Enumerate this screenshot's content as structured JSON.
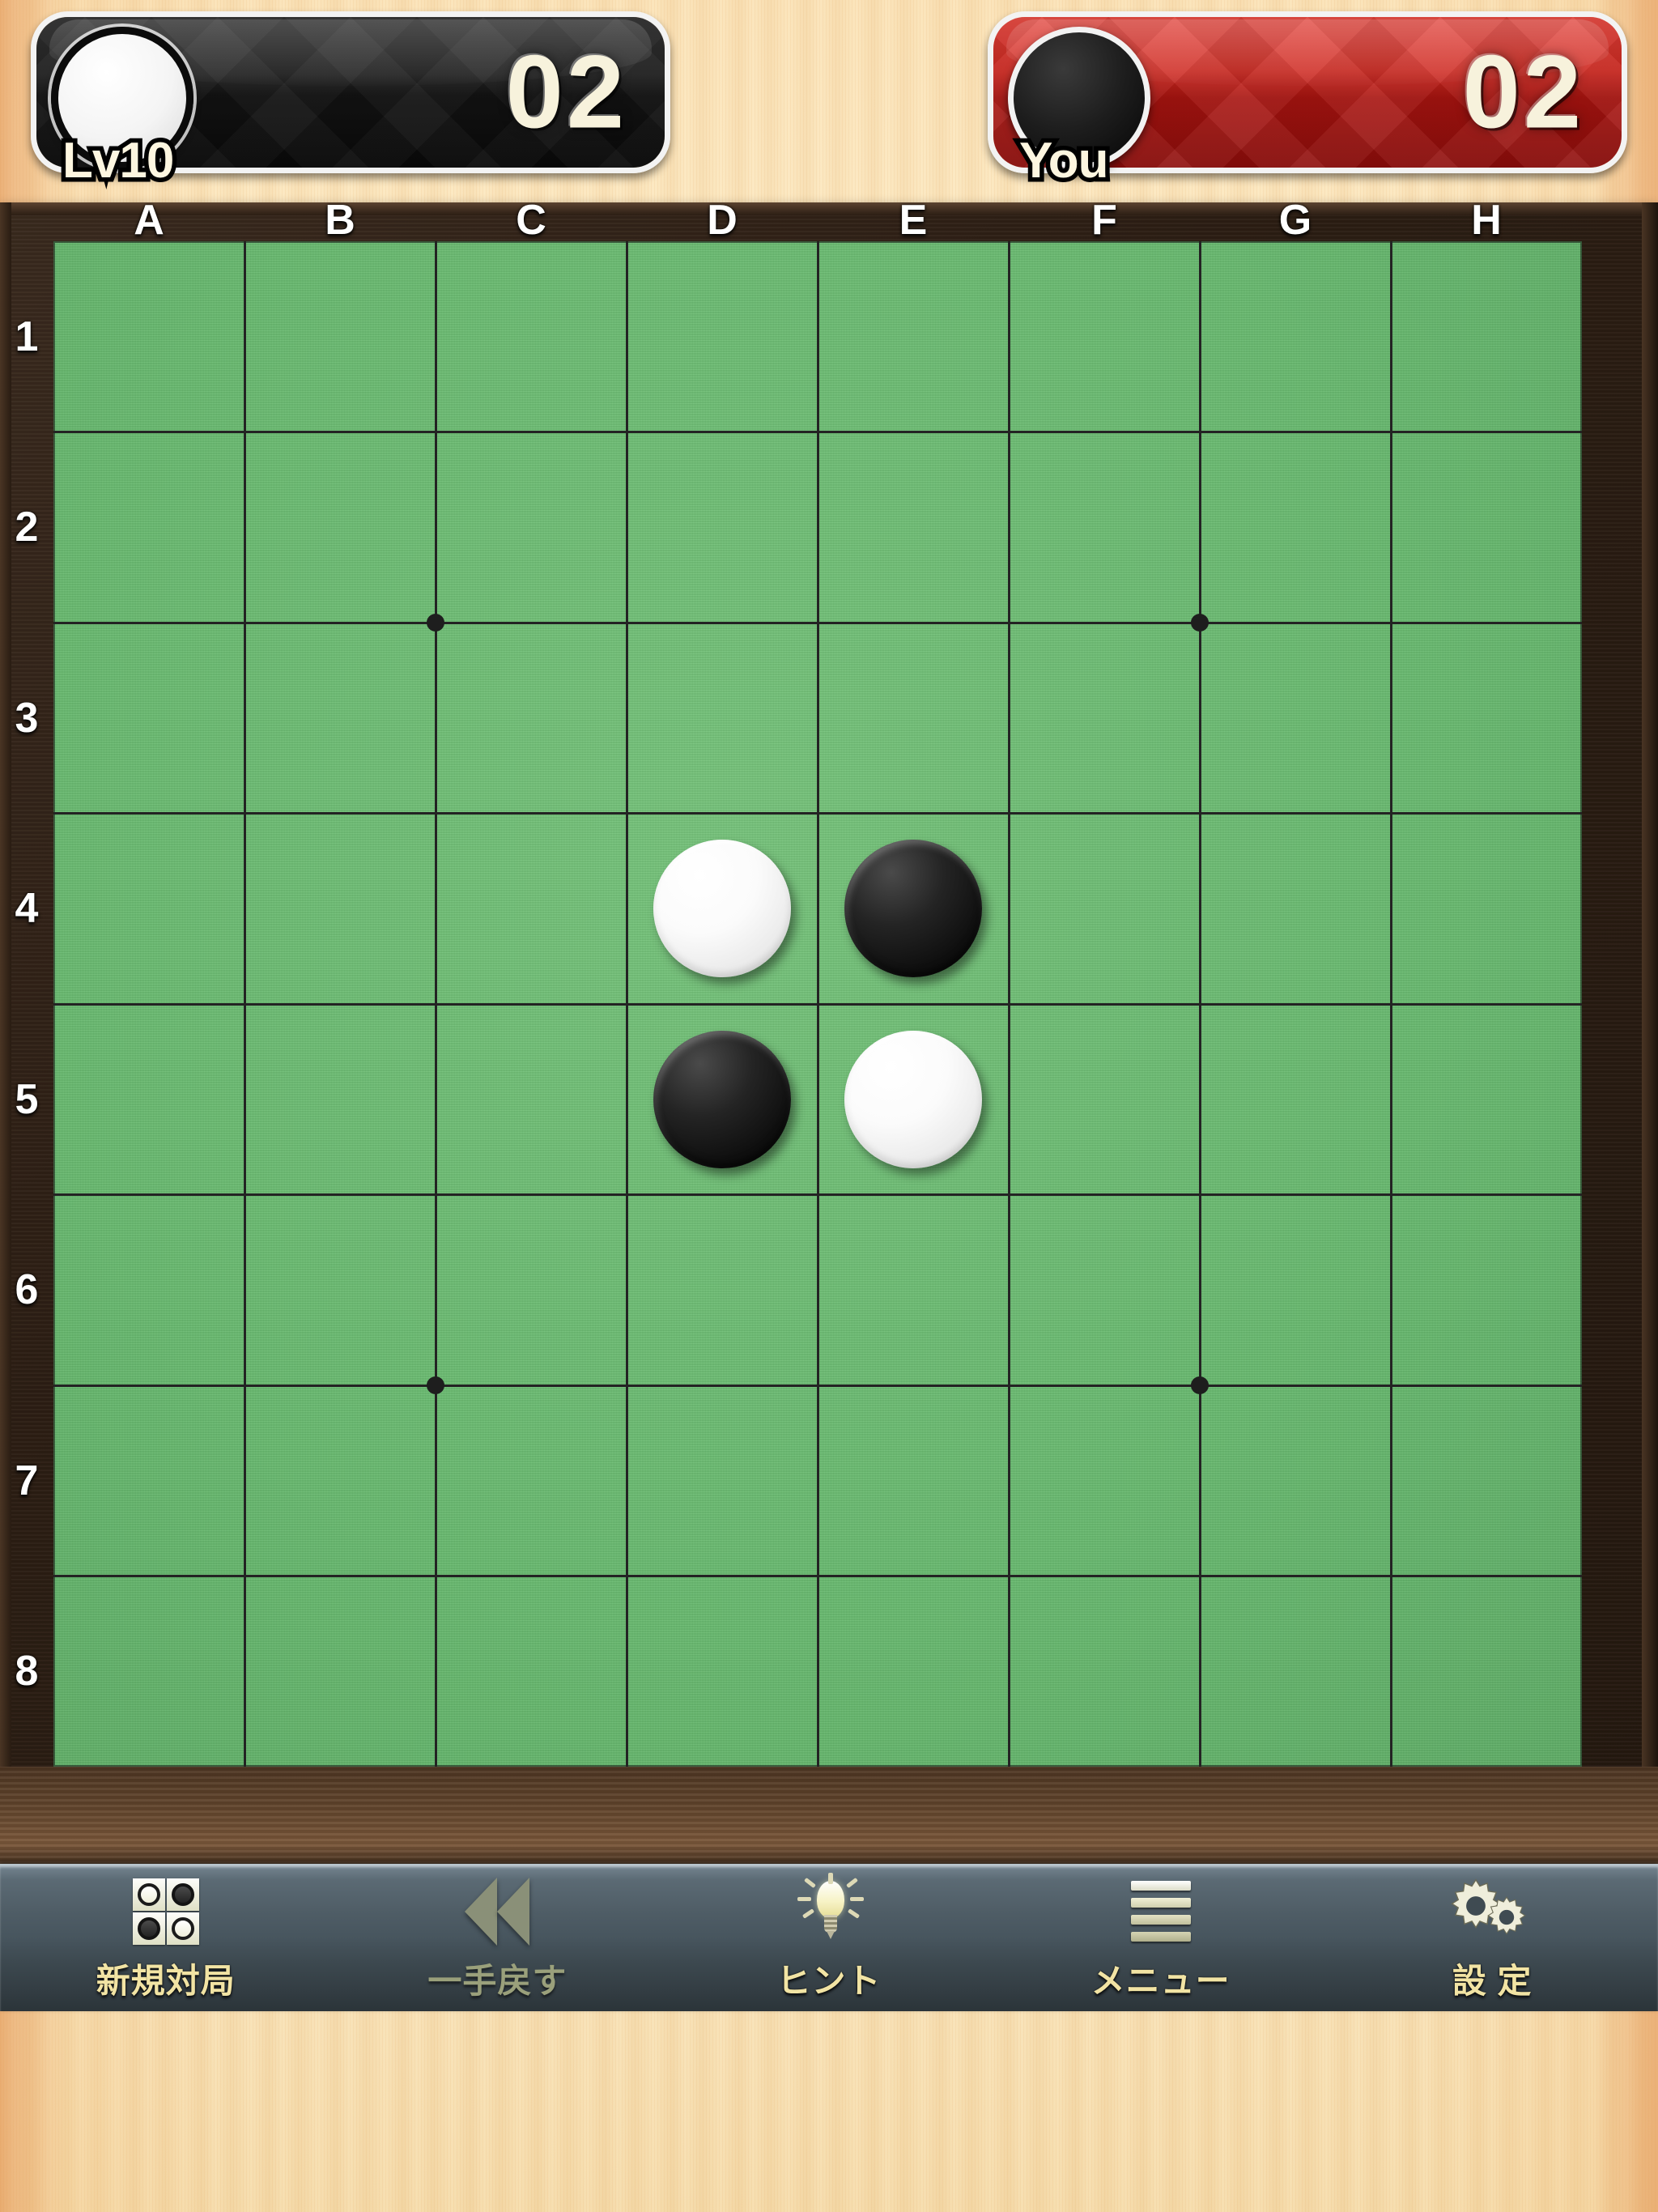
{
  "players": {
    "cpu": {
      "name": "Lv10",
      "score": "02",
      "disc_color": "white",
      "panel_color": "#121212"
    },
    "you": {
      "name": "You",
      "score": "02",
      "disc_color": "black",
      "panel_color": "#c52a22"
    }
  },
  "board": {
    "columns": [
      "A",
      "B",
      "C",
      "D",
      "E",
      "F",
      "G",
      "H"
    ],
    "rows": [
      "1",
      "2",
      "3",
      "4",
      "5",
      "6",
      "7",
      "8"
    ],
    "felt_color": "#69bb70",
    "frame_color": "#2b1d13",
    "gridline_color": "#232323",
    "size": 8,
    "pieces": [
      {
        "square": "D4",
        "col": 3,
        "row": 3,
        "color": "white"
      },
      {
        "square": "E4",
        "col": 4,
        "row": 3,
        "color": "black"
      },
      {
        "square": "D5",
        "col": 3,
        "row": 4,
        "color": "black"
      },
      {
        "square": "E5",
        "col": 4,
        "row": 4,
        "color": "white"
      }
    ],
    "star_points": [
      {
        "col": 2,
        "row": 2
      },
      {
        "col": 6,
        "row": 2
      },
      {
        "col": 2,
        "row": 6
      },
      {
        "col": 6,
        "row": 6
      }
    ]
  },
  "toolbar": {
    "items": [
      {
        "label": "新規対局",
        "icon": "new-game-icon",
        "enabled": true
      },
      {
        "label": "一手戻す",
        "icon": "undo-icon",
        "enabled": false
      },
      {
        "label": "ヒント",
        "icon": "hint-bulb-icon",
        "enabled": true
      },
      {
        "label": "メニュー",
        "icon": "menu-hamburger-icon",
        "enabled": true
      },
      {
        "label": "設 定",
        "icon": "settings-gears-icon",
        "enabled": true
      }
    ]
  }
}
